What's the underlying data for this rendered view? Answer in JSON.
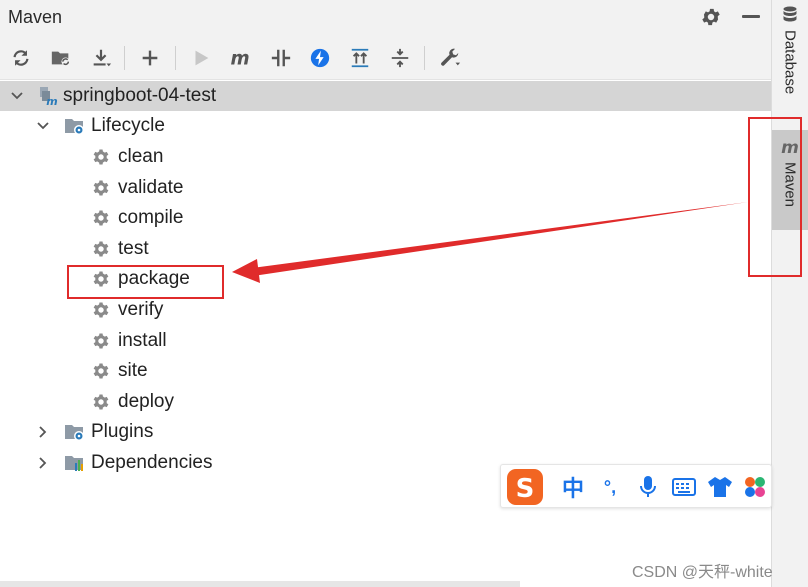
{
  "panel": {
    "title": "Maven"
  },
  "tree": {
    "root": "springboot-04-test",
    "lifecycle": "Lifecycle",
    "phases": [
      "clean",
      "validate",
      "compile",
      "test",
      "package",
      "verify",
      "install",
      "site",
      "deploy"
    ],
    "plugins": "Plugins",
    "dependencies": "Dependencies"
  },
  "side_tabs": {
    "database": "Database",
    "maven": "Maven"
  },
  "ime": {
    "chinese": "中",
    "punct": "°,"
  },
  "watermark": "CSDN @天秤-white",
  "colors": {
    "annotation": "#e02b2b",
    "selection": "#d5d5d5",
    "accent_blue": "#1a73e8",
    "ime_orange": "#f26522"
  }
}
